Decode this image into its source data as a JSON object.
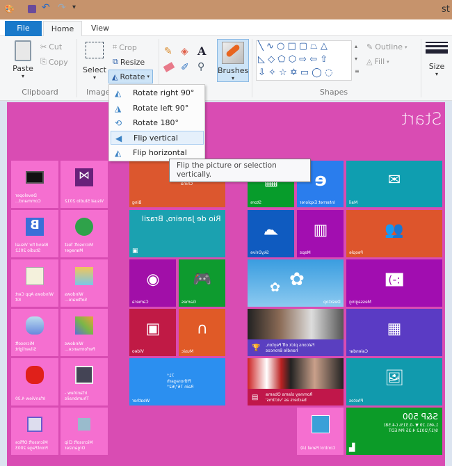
{
  "title_bar": {
    "title_fragment": "st",
    "quick_access": [
      "paint-icon",
      "save-icon",
      "undo-icon",
      "redo-icon",
      "customize-icon"
    ]
  },
  "tabs": [
    "File",
    "Home",
    "View"
  ],
  "ribbon": {
    "clipboard": {
      "paste": "Paste",
      "cut": "Cut",
      "copy": "Copy",
      "group": "Clipboard"
    },
    "image": {
      "select": "Select",
      "crop": "Crop",
      "resize": "Resize",
      "rotate": "Rotate",
      "group": "Image"
    },
    "brushes": "Brushes",
    "shapes": {
      "outline": "Outline",
      "fill": "Fill",
      "group": "Shapes"
    },
    "size": "Size"
  },
  "rotate_menu": [
    "Rotate right 90°",
    "Rotate left 90°",
    "Rotate 180°",
    "Flip vertical",
    "Flip horizontal"
  ],
  "tooltip": "Flip the picture or selection vertically.",
  "canvas": {
    "start": "Start",
    "desktop_tiles": [
      "Developer Command...",
      "Visual Studio 2012",
      "Blend for Visual Studio 2012",
      "Microsoft Test Manager",
      "Windows App Cert Kit",
      "Windows Software...",
      "Microsoft Silverlight",
      "Windows Performance...",
      "IrfanView 4.30",
      "IrfanView - Thumbnails",
      "Microsoft Office FrontPage 2003",
      "Microsoft Clip Organizer"
    ],
    "bing": {
      "label": "Bing",
      "text": "Chris Brown Obama China"
    },
    "rio": {
      "text": "Rio de Janeiro, Brazil"
    },
    "camera": "Camera",
    "games": "Games",
    "video": "Video",
    "music": "Music",
    "weather": {
      "label": "Weather",
      "text": "71° Pithoragarh Rain 76°/62°"
    },
    "store": "Store",
    "ie": "Internet Explorer",
    "mail": "Mail",
    "skydrive": "SkyDrive",
    "maps": "Maps",
    "people": "People",
    "desktop": "Desktop",
    "messaging": "Messaging",
    "sports": "Falcons pick off Peyton, handle Broncos",
    "calendar": "Calendar",
    "news": "Romney slams Obama backers as 'victims'",
    "photos": "Photos",
    "control_panel": "Control Panel (4)",
    "finance": {
      "title": "S&P 500",
      "line1": "1,461.19 ▼ -0.31% (-4.58)",
      "line2": "9/17/2012 4:35 PM EDT"
    }
  }
}
